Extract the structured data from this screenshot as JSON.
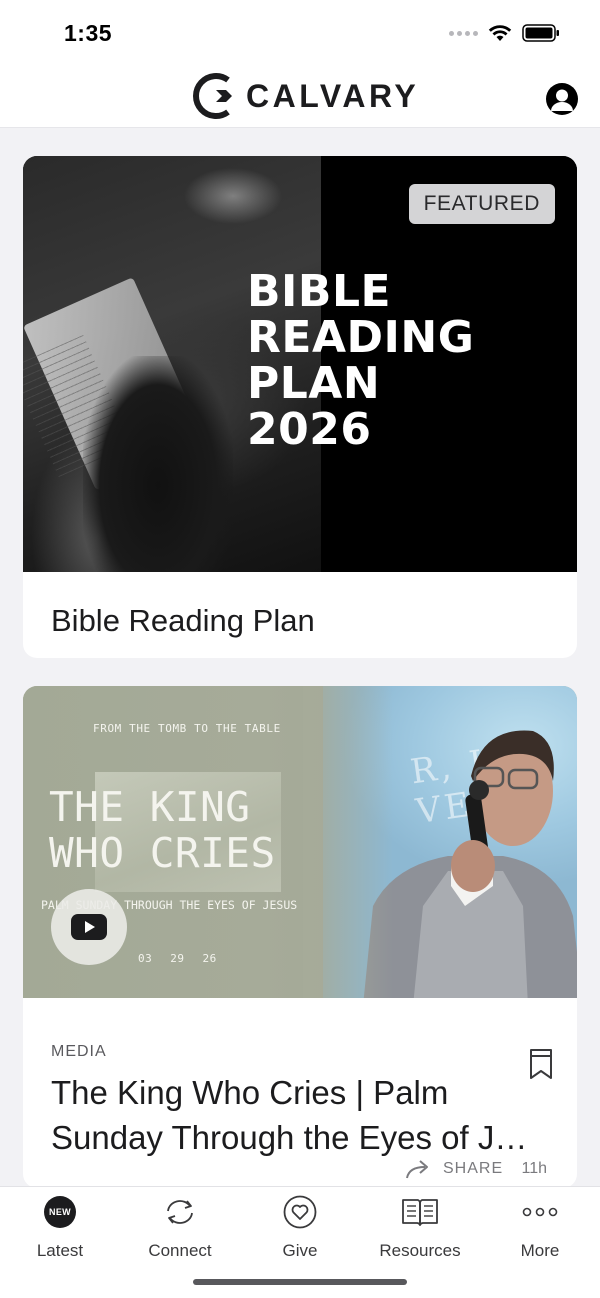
{
  "status_bar": {
    "time": "1:35"
  },
  "header": {
    "logo_text": "CALVARY",
    "profile_icon": "person-circle-icon"
  },
  "feed": {
    "featured_card": {
      "badge": "FEATURED",
      "image_title_lines": [
        "BIBLE",
        "READING",
        "PLAN",
        "2026"
      ],
      "title": "Bible Reading Plan"
    },
    "media_card": {
      "image_text": {
        "kicker": "FROM THE TOMB TO THE TABLE",
        "title_line_1": "THE KING",
        "title_line_2": "WHO CRIES",
        "subtitle": "PALM SUNDAY THROUGH THE EYES OF JESUS",
        "date": [
          "03",
          "29",
          "26"
        ]
      },
      "play_icon": "play-icon",
      "category": "MEDIA",
      "title_line_1": "The King Who Cries | Palm",
      "title_line_2": "Sunday Through the Eyes of J…",
      "share_label": "SHARE",
      "time_ago": "11h"
    }
  },
  "tab_bar": {
    "tabs": [
      {
        "label": "Latest",
        "icon": "new-badge-icon",
        "badge": "NEW"
      },
      {
        "label": "Connect",
        "icon": "connect-icon"
      },
      {
        "label": "Give",
        "icon": "heart-icon"
      },
      {
        "label": "Resources",
        "icon": "book-icon"
      },
      {
        "label": "More",
        "icon": "more-dots-icon"
      }
    ]
  },
  "colors": {
    "background": "#f2f2f5",
    "card": "#ffffff",
    "text": "#1c1c1e",
    "muted": "#7a7a7e",
    "badge_bg": "#d4d4d6"
  }
}
